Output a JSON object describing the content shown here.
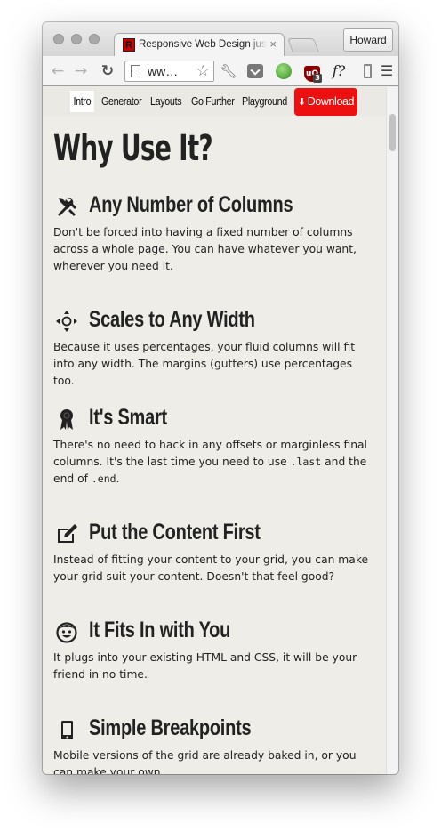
{
  "browser": {
    "tab_title": "Responsive Web Design just",
    "tab_favicon_letter": "R",
    "tab_close": "×",
    "profile_name": "Howard",
    "url_text": "ww…",
    "icons": [
      "back-icon",
      "forward-icon",
      "reload-icon",
      "page-icon",
      "star-icon",
      "wrench-icon",
      "pocket-icon",
      "globe-icon",
      "ublock-icon",
      "font-icon",
      "extension-icon",
      "menu-icon"
    ],
    "ublock_badge": "3",
    "font_ext_label": "f?"
  },
  "nav": {
    "items": [
      {
        "label": "Intro",
        "active": true
      },
      {
        "label": "Generator"
      },
      {
        "label": "Layouts"
      },
      {
        "label": "Go Further"
      },
      {
        "label": "Playground"
      }
    ],
    "download_label": "Download",
    "download_color": "#ee1010"
  },
  "main": {
    "title": "Why Use It?",
    "sections": [
      {
        "icon": "tools-icon",
        "title": "Any Number of Columns",
        "body": "Don't be forced into having a fixed number of columns across a whole page. You can have whatever you want, wherever you need it."
      },
      {
        "icon": "resize-icon",
        "title": "Scales to Any Width",
        "body": "Because it uses percentages, your fluid columns will fit into any width. The margins (gutters) use percentages too."
      },
      {
        "icon": "ribbon-icon",
        "title": "It's Smart",
        "body_pre": "There's no need to hack in any offsets or marginless final columns. It's the last time you need to use ",
        "code1": ".last",
        "body_mid": " and the end of ",
        "code2": ".end",
        "body_post": "."
      },
      {
        "icon": "edit-icon",
        "title": "Put the Content First",
        "body": "Instead of fitting your content to your grid, you can make your grid suit your content. Doesn't that feel good?"
      },
      {
        "icon": "smiley-icon",
        "title": "It Fits In with You",
        "body": "It plugs into your existing HTML and CSS, it will be your friend in no time."
      },
      {
        "icon": "mobile-icon",
        "title": "Simple Breakpoints",
        "body": "Mobile versions of the grid are already baked in, or you can make your own."
      }
    ]
  }
}
